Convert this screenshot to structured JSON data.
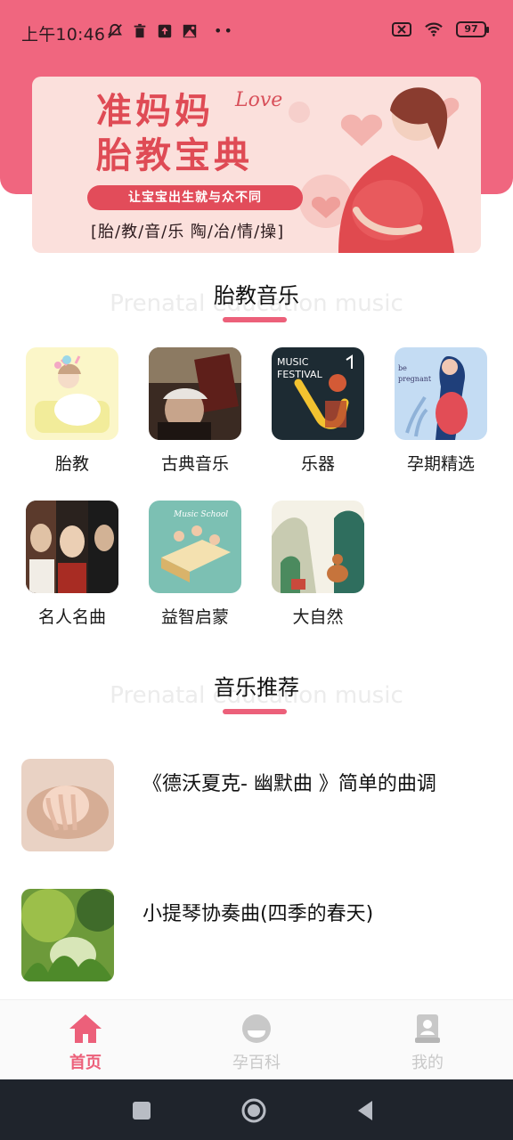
{
  "status_bar": {
    "time": "上午10:46",
    "battery": "97",
    "icons": [
      "mute-bell-icon",
      "trash-icon",
      "upload-icon",
      "image-icon",
      "more-dots-icon",
      "sim-off-icon",
      "wifi-icon",
      "battery-icon"
    ]
  },
  "banner": {
    "title_line1": "准妈妈",
    "title_line2": "胎教宝典",
    "love": "Love",
    "pill": "让宝宝出生就与众不同",
    "subtitle": "[胎/教/音/乐 陶/冶/情/操]"
  },
  "section_music": {
    "title": "胎教音乐",
    "ghost": "Prenatal education music"
  },
  "categories": [
    {
      "label": "胎教",
      "icon": "mother-baby-illustration"
    },
    {
      "label": "古典音乐",
      "icon": "classical-composer-photo"
    },
    {
      "label": "乐器",
      "icon": "music-festival-saxophone"
    },
    {
      "label": "孕期精选",
      "icon": "pregnant-woman-illustration"
    },
    {
      "label": "名人名曲",
      "icon": "famous-composers-portraits"
    },
    {
      "label": "益智启蒙",
      "icon": "music-school-kids"
    },
    {
      "label": "大自然",
      "icon": "nature-deer-illustration"
    }
  ],
  "section_recommend": {
    "title": "音乐推荐",
    "ghost": "Prenatal education music"
  },
  "recommendations": [
    {
      "title": "《德沃夏克- 幽默曲 》简单的曲调",
      "thumb": "baby-hands-photo"
    },
    {
      "title": "小提琴协奏曲(四季的春天)",
      "thumb": "spring-grass-photo"
    }
  ],
  "bottom_nav": [
    {
      "label": "首页",
      "icon": "home-icon",
      "active": true
    },
    {
      "label": "孕百科",
      "icon": "encyclopedia-icon",
      "active": false
    },
    {
      "label": "我的",
      "icon": "profile-icon",
      "active": false
    }
  ],
  "colors": {
    "accent": "#f0667f",
    "nav_active": "#ec607a",
    "nav_inactive": "#c8c8c8",
    "system_nav": "#1f242c"
  }
}
